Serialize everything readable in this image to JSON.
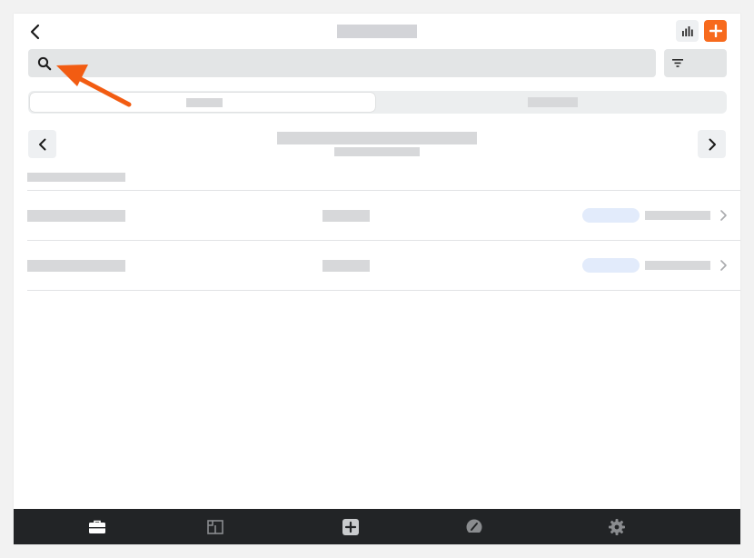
{
  "header": {
    "back_icon": "chevron-left-icon",
    "chart_icon": "bar-chart-icon",
    "add_icon": "plus-icon",
    "accent_color": "#f76a1d"
  },
  "search": {
    "icon": "search-icon",
    "placeholder": "",
    "value": ""
  },
  "filter": {
    "icon": "filter-icon"
  },
  "segments": {
    "active_index": 0,
    "count": 2
  },
  "date_nav": {
    "prev_icon": "chevron-left-icon",
    "next_icon": "chevron-right-icon"
  },
  "list": {
    "rows": [
      {
        "status_badge_color": "#e2ebfb",
        "chevron_icon": "chevron-right-icon"
      },
      {
        "status_badge_color": "#e2ebfb",
        "chevron_icon": "chevron-right-icon"
      }
    ]
  },
  "bottom_nav": {
    "background": "#222426",
    "items": [
      {
        "icon": "briefcase-icon",
        "active": true
      },
      {
        "icon": "floor-plan-icon",
        "active": false
      },
      {
        "icon": "add-square-icon",
        "active": false
      },
      {
        "icon": "dashboard-gauge-icon",
        "active": false
      },
      {
        "icon": "gear-icon",
        "active": false
      }
    ]
  },
  "annotation": {
    "icon": "arrow-icon",
    "color": "#f25c12"
  }
}
